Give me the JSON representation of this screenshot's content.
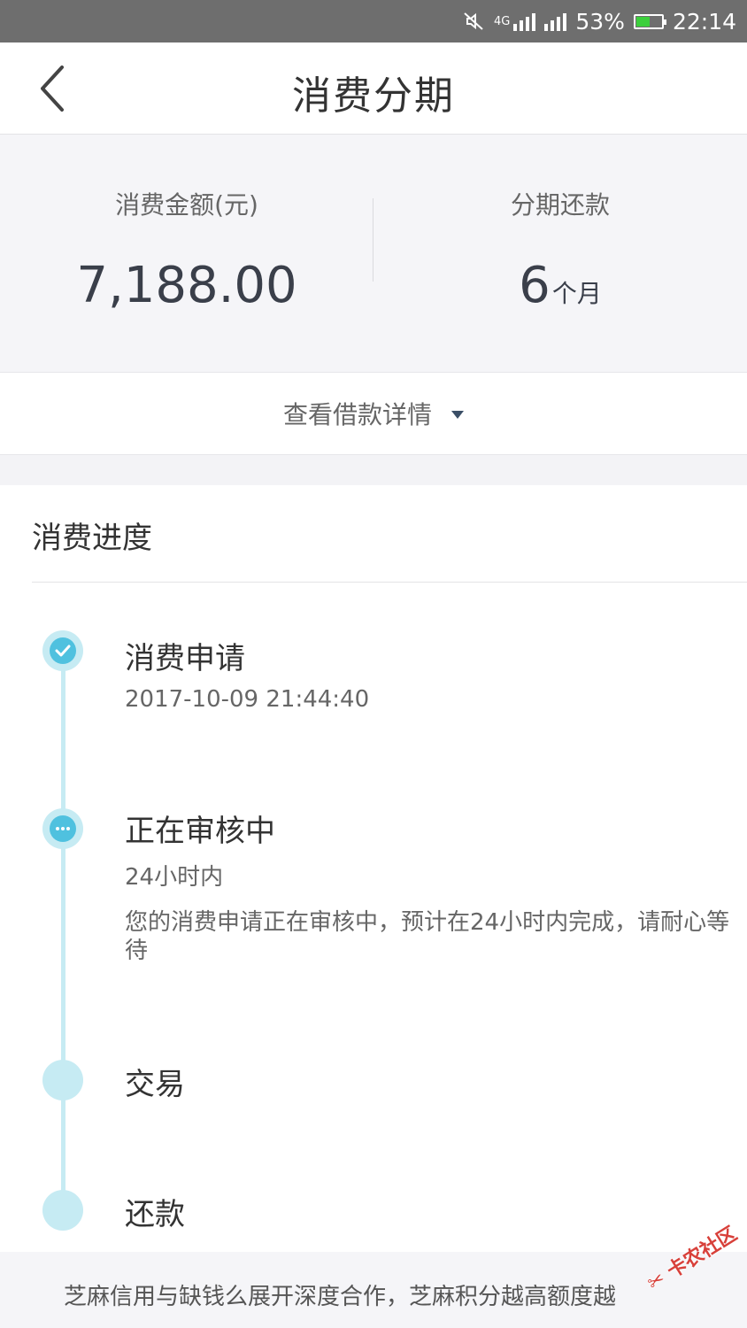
{
  "status_bar": {
    "network": "4G",
    "battery_percent": "53%",
    "battery_level": 0.53,
    "time": "22:14",
    "icons": [
      "mute-icon",
      "signal-4g-icon",
      "signal-icon",
      "battery-icon"
    ]
  },
  "header": {
    "title": "消费分期",
    "back_icon": "chevron-left-icon"
  },
  "summary": {
    "amount_label": "消费金额(元)",
    "amount_value": "7,188.00",
    "installment_label": "分期还款",
    "installment_value": "6",
    "installment_unit": "个月"
  },
  "details": {
    "label": "查看借款详情",
    "icon": "caret-down-icon"
  },
  "progress": {
    "title": "消费进度",
    "steps": [
      {
        "title": "消费申请",
        "subtitle": "2017-10-09 21:44:40",
        "status": "done",
        "icon": "check-icon"
      },
      {
        "title": "正在审核中",
        "subtitle": "24小时内",
        "description": "您的消费申请正在审核中，预计在24小时内完成，请耐心等待",
        "status": "current",
        "icon": "ellipsis-icon"
      },
      {
        "title": "交易",
        "status": "pending"
      },
      {
        "title": "还款",
        "status": "pending"
      }
    ]
  },
  "footer": {
    "text": "芝麻信用与缺钱么展开深度合作，芝麻积分越高额度越"
  },
  "watermark": {
    "text": "卡农社区"
  },
  "colors": {
    "accent": "#4fc1df",
    "timeline": "#c6ebf3",
    "status_bar": "#6e6e6e",
    "battery": "#3ccf3c"
  }
}
